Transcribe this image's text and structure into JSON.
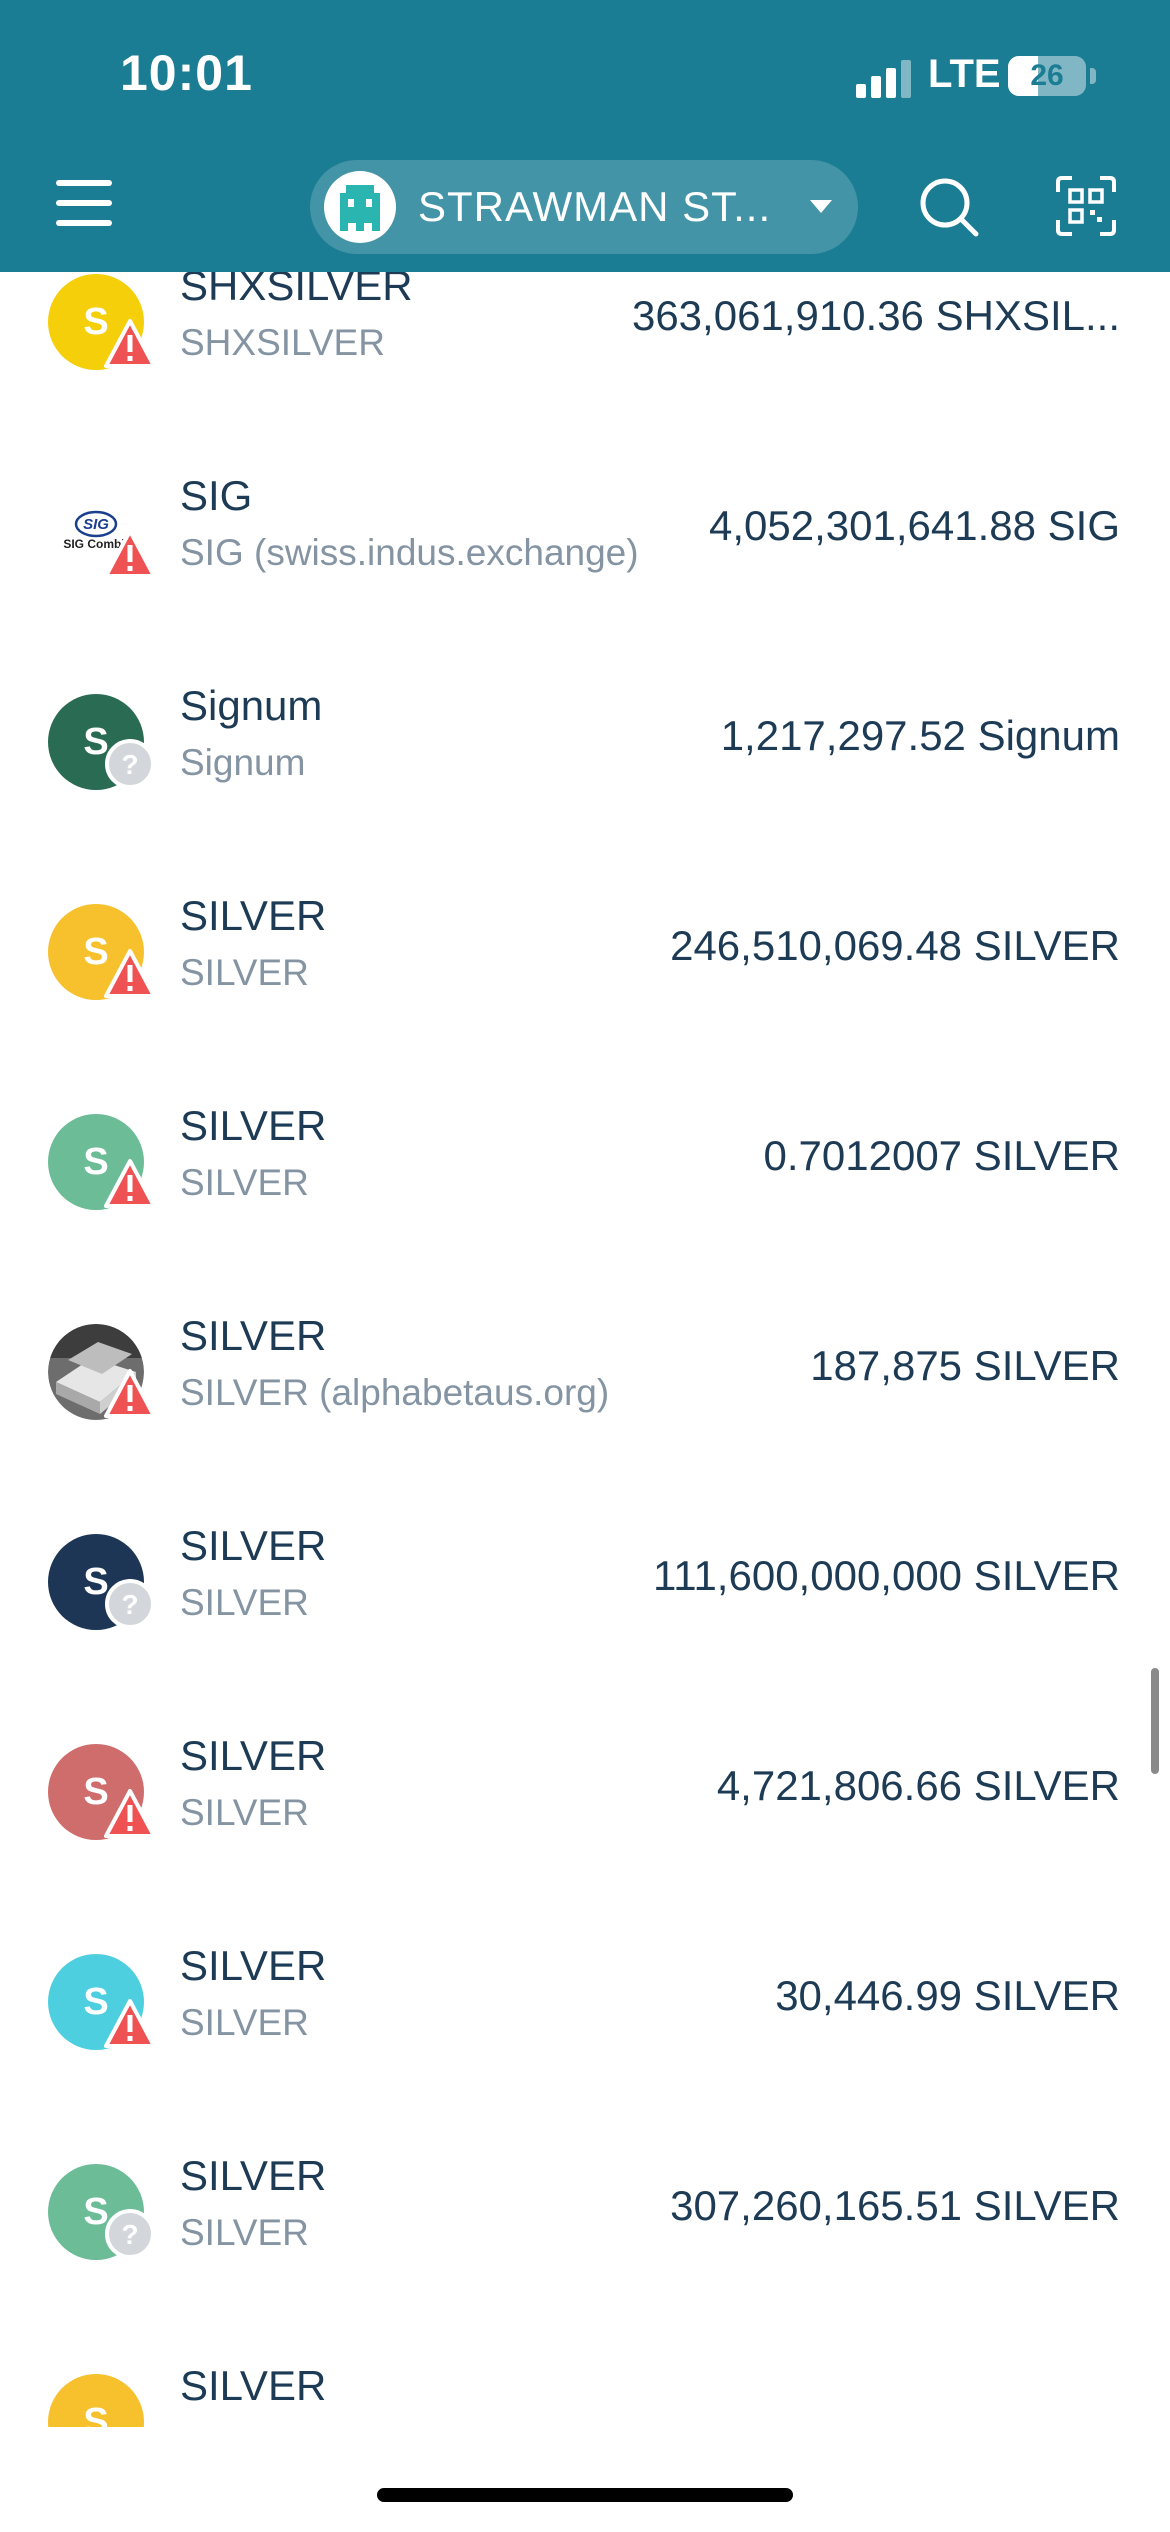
{
  "status_bar": {
    "time": "10:01",
    "network": "LTE",
    "battery": "26"
  },
  "header": {
    "menu_icon": "hamburger-icon",
    "account_name": "STRAWMAN ST...",
    "search_icon": "search-icon",
    "scan_icon": "qr-scan-icon",
    "color": "#1b7d94"
  },
  "tokens": [
    {
      "name": "SHXSILVER",
      "sub": "SHXSILVER",
      "amount": "363,061,910.36 SHXSIL...",
      "letter": "S",
      "color": "#f4cf0a",
      "badge": "warning"
    },
    {
      "name": "SIG",
      "sub": "SIG (swiss.indus.exchange)",
      "amount": "4,052,301,641.88 SIG",
      "letter": "",
      "color": "#ffffff",
      "badge": "warning",
      "logo_text": "SIG Combit"
    },
    {
      "name": "Signum",
      "sub": "Signum",
      "amount": "1,217,297.52 Signum",
      "letter": "S",
      "color": "#2a6b54",
      "badge": "unknown"
    },
    {
      "name": "SILVER",
      "sub": "SILVER",
      "amount": "246,510,069.48 SILVER",
      "letter": "S",
      "color": "#f6c12d",
      "badge": "warning"
    },
    {
      "name": "SILVER",
      "sub": "SILVER",
      "amount": "0.7012007 SILVER",
      "letter": "S",
      "color": "#6cbc97",
      "badge": "warning"
    },
    {
      "name": "SILVER",
      "sub": "SILVER (alphabetaus.org)",
      "amount": "187,875 SILVER",
      "letter": "",
      "color": "#9a9a9a",
      "badge": "warning"
    },
    {
      "name": "SILVER",
      "sub": "SILVER",
      "amount": "111,600,000,000 SILVER",
      "letter": "S",
      "color": "#1d3656",
      "badge": "unknown"
    },
    {
      "name": "SILVER",
      "sub": "SILVER",
      "amount": "4,721,806.66 SILVER",
      "letter": "S",
      "color": "#cf6d6d",
      "badge": "warning"
    },
    {
      "name": "SILVER",
      "sub": "SILVER",
      "amount": "30,446.99 SILVER",
      "letter": "S",
      "color": "#4ecfdf",
      "badge": "warning"
    },
    {
      "name": "SILVER",
      "sub": "SILVER",
      "amount": "307,260,165.51 SILVER",
      "letter": "S",
      "color": "#6cbc97",
      "badge": "unknown"
    },
    {
      "name": "SILVER",
      "sub": "",
      "amount": "",
      "letter": "S",
      "color": "#f6c12d",
      "badge": "none"
    }
  ]
}
